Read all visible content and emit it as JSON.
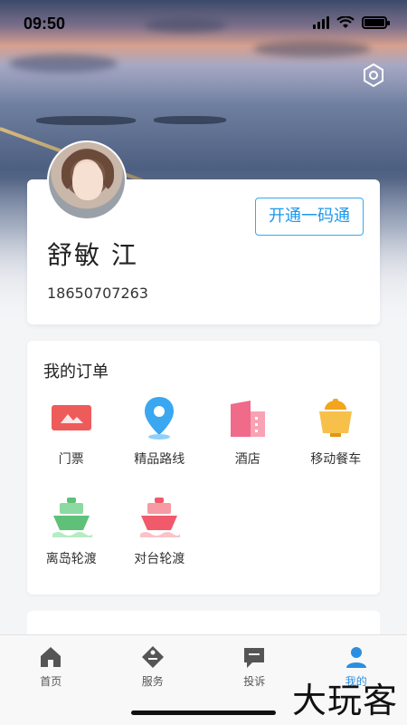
{
  "status_bar": {
    "time": "09:50"
  },
  "profile": {
    "open_button_label": "开通一码通",
    "name": "舒敏 江",
    "phone": "18650707263"
  },
  "orders": {
    "title": "我的订单",
    "items": [
      {
        "label": "门票",
        "icon": "ticket-icon",
        "color": "#ee5b5b"
      },
      {
        "label": "精品路线",
        "icon": "location-pin-icon",
        "color": "#3aa7f0"
      },
      {
        "label": "酒店",
        "icon": "hotel-icon",
        "color": "#f06a8a"
      },
      {
        "label": "移动餐车",
        "icon": "food-cart-icon",
        "color": "#f3a51c"
      },
      {
        "label": "离岛轮渡",
        "icon": "ferry-icon",
        "color": "#5fc07a"
      },
      {
        "label": "对台轮渡",
        "icon": "ferry-icon",
        "color": "#f05a6a"
      }
    ]
  },
  "tabbar": {
    "tabs": [
      {
        "label": "首页",
        "icon": "home-icon"
      },
      {
        "label": "服务",
        "icon": "service-tag-icon"
      },
      {
        "label": "投诉",
        "icon": "complaint-message-icon"
      },
      {
        "label": "我的",
        "icon": "user-icon",
        "active": true
      }
    ]
  },
  "watermark": "大玩客",
  "colors": {
    "accent": "#1a98ee"
  }
}
